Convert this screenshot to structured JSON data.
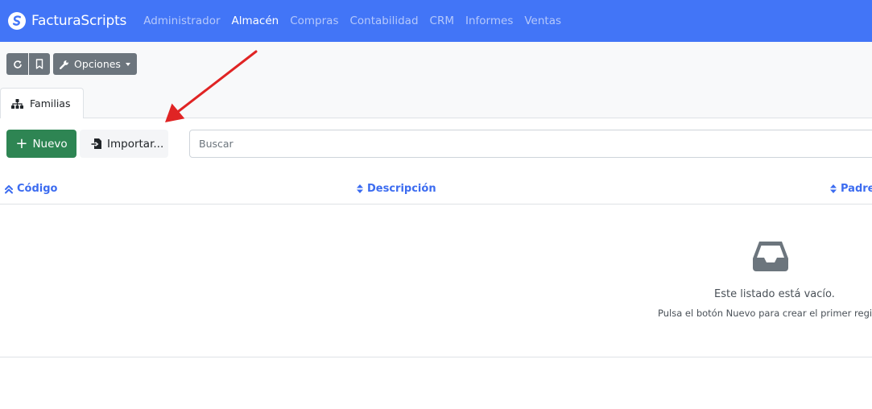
{
  "app": {
    "name": "FacturaScripts"
  },
  "nav": {
    "items": [
      {
        "label": "Administrador",
        "active": false
      },
      {
        "label": "Almacén",
        "active": true
      },
      {
        "label": "Compras",
        "active": false
      },
      {
        "label": "Contabilidad",
        "active": false
      },
      {
        "label": "CRM",
        "active": false
      },
      {
        "label": "Informes",
        "active": false
      },
      {
        "label": "Ventas",
        "active": false
      }
    ]
  },
  "toolbar": {
    "options_label": "Opciones"
  },
  "tabs": [
    {
      "label": "Familias",
      "icon": "sitemap-icon"
    }
  ],
  "actions": {
    "new_label": "Nuevo",
    "import_label": "Importar..."
  },
  "search": {
    "placeholder": "Buscar",
    "value": ""
  },
  "table": {
    "columns": [
      {
        "label": "Código",
        "sort": "asc"
      },
      {
        "label": "Descripción",
        "sort": "none"
      },
      {
        "label": "Padre",
        "sort": "none"
      }
    ],
    "rows": []
  },
  "empty": {
    "title": "Este listado está vacío.",
    "subtitle": "Pulsa el botón Nuevo para crear el primer registro."
  },
  "colors": {
    "navbar": "#4275f7",
    "nav_inactive": "#b5c8fb",
    "button_secondary": "#6c757d",
    "button_success": "#2e8553",
    "column_header": "#3c6cf0",
    "annotation_arrow": "#e02424"
  }
}
